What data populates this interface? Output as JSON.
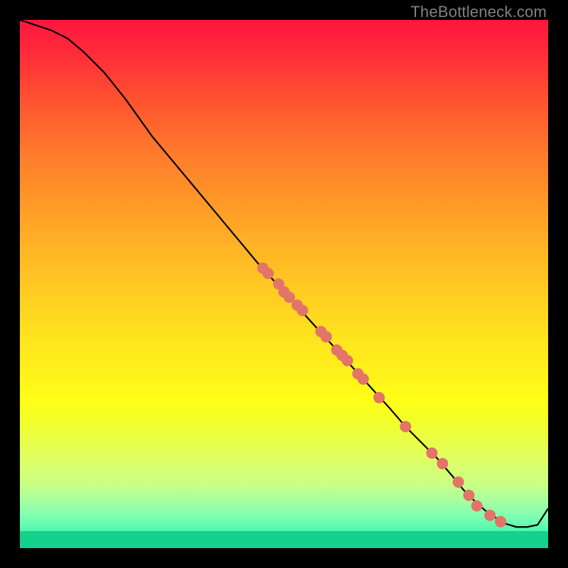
{
  "watermark": "TheBottleneck.com",
  "chart_data": {
    "type": "line",
    "title": "",
    "xlabel": "",
    "ylabel": "",
    "xlim": [
      0,
      100
    ],
    "ylim": [
      0,
      100
    ],
    "grid": false,
    "legend": false,
    "background_gradient_stops": [
      {
        "pos": 0.0,
        "color": "#ff163e"
      },
      {
        "pos": 0.5,
        "color": "#ffc822"
      },
      {
        "pos": 0.72,
        "color": "#feff16"
      },
      {
        "pos": 1.0,
        "color": "#14d28e"
      }
    ],
    "series": [
      {
        "name": "curve",
        "color": "#000000",
        "x": [
          0,
          3,
          6,
          9,
          12,
          16,
          20,
          25,
          30,
          35,
          40,
          45,
          50,
          55,
          60,
          65,
          70,
          73,
          76,
          79,
          82,
          84,
          86,
          88,
          90,
          92,
          94,
          96,
          98,
          100
        ],
        "y": [
          100,
          99,
          98,
          96.5,
          94,
          90,
          85,
          78,
          72,
          66,
          60,
          54,
          48.5,
          43,
          37.5,
          32,
          26.5,
          23,
          20,
          17,
          13.5,
          11,
          9,
          7.2,
          5.8,
          4.6,
          4,
          4,
          4.4,
          7.5
        ]
      }
    ],
    "points": {
      "name": "markers",
      "color": "#e37468",
      "radius": 8,
      "data": [
        {
          "x": 46,
          "y": 53
        },
        {
          "x": 47,
          "y": 52
        },
        {
          "x": 49,
          "y": 50
        },
        {
          "x": 50,
          "y": 48.5
        },
        {
          "x": 51,
          "y": 47.5
        },
        {
          "x": 52.5,
          "y": 46
        },
        {
          "x": 53.5,
          "y": 45
        },
        {
          "x": 57,
          "y": 41
        },
        {
          "x": 58,
          "y": 40
        },
        {
          "x": 60,
          "y": 37.5
        },
        {
          "x": 61,
          "y": 36.5
        },
        {
          "x": 62,
          "y": 35.5
        },
        {
          "x": 64,
          "y": 33
        },
        {
          "x": 65,
          "y": 32
        },
        {
          "x": 68,
          "y": 28.5
        },
        {
          "x": 73,
          "y": 23
        },
        {
          "x": 78,
          "y": 18
        },
        {
          "x": 80,
          "y": 16
        },
        {
          "x": 83,
          "y": 12.5
        },
        {
          "x": 85,
          "y": 10
        },
        {
          "x": 86.5,
          "y": 8
        },
        {
          "x": 89,
          "y": 6.2
        },
        {
          "x": 91,
          "y": 5
        }
      ]
    }
  }
}
